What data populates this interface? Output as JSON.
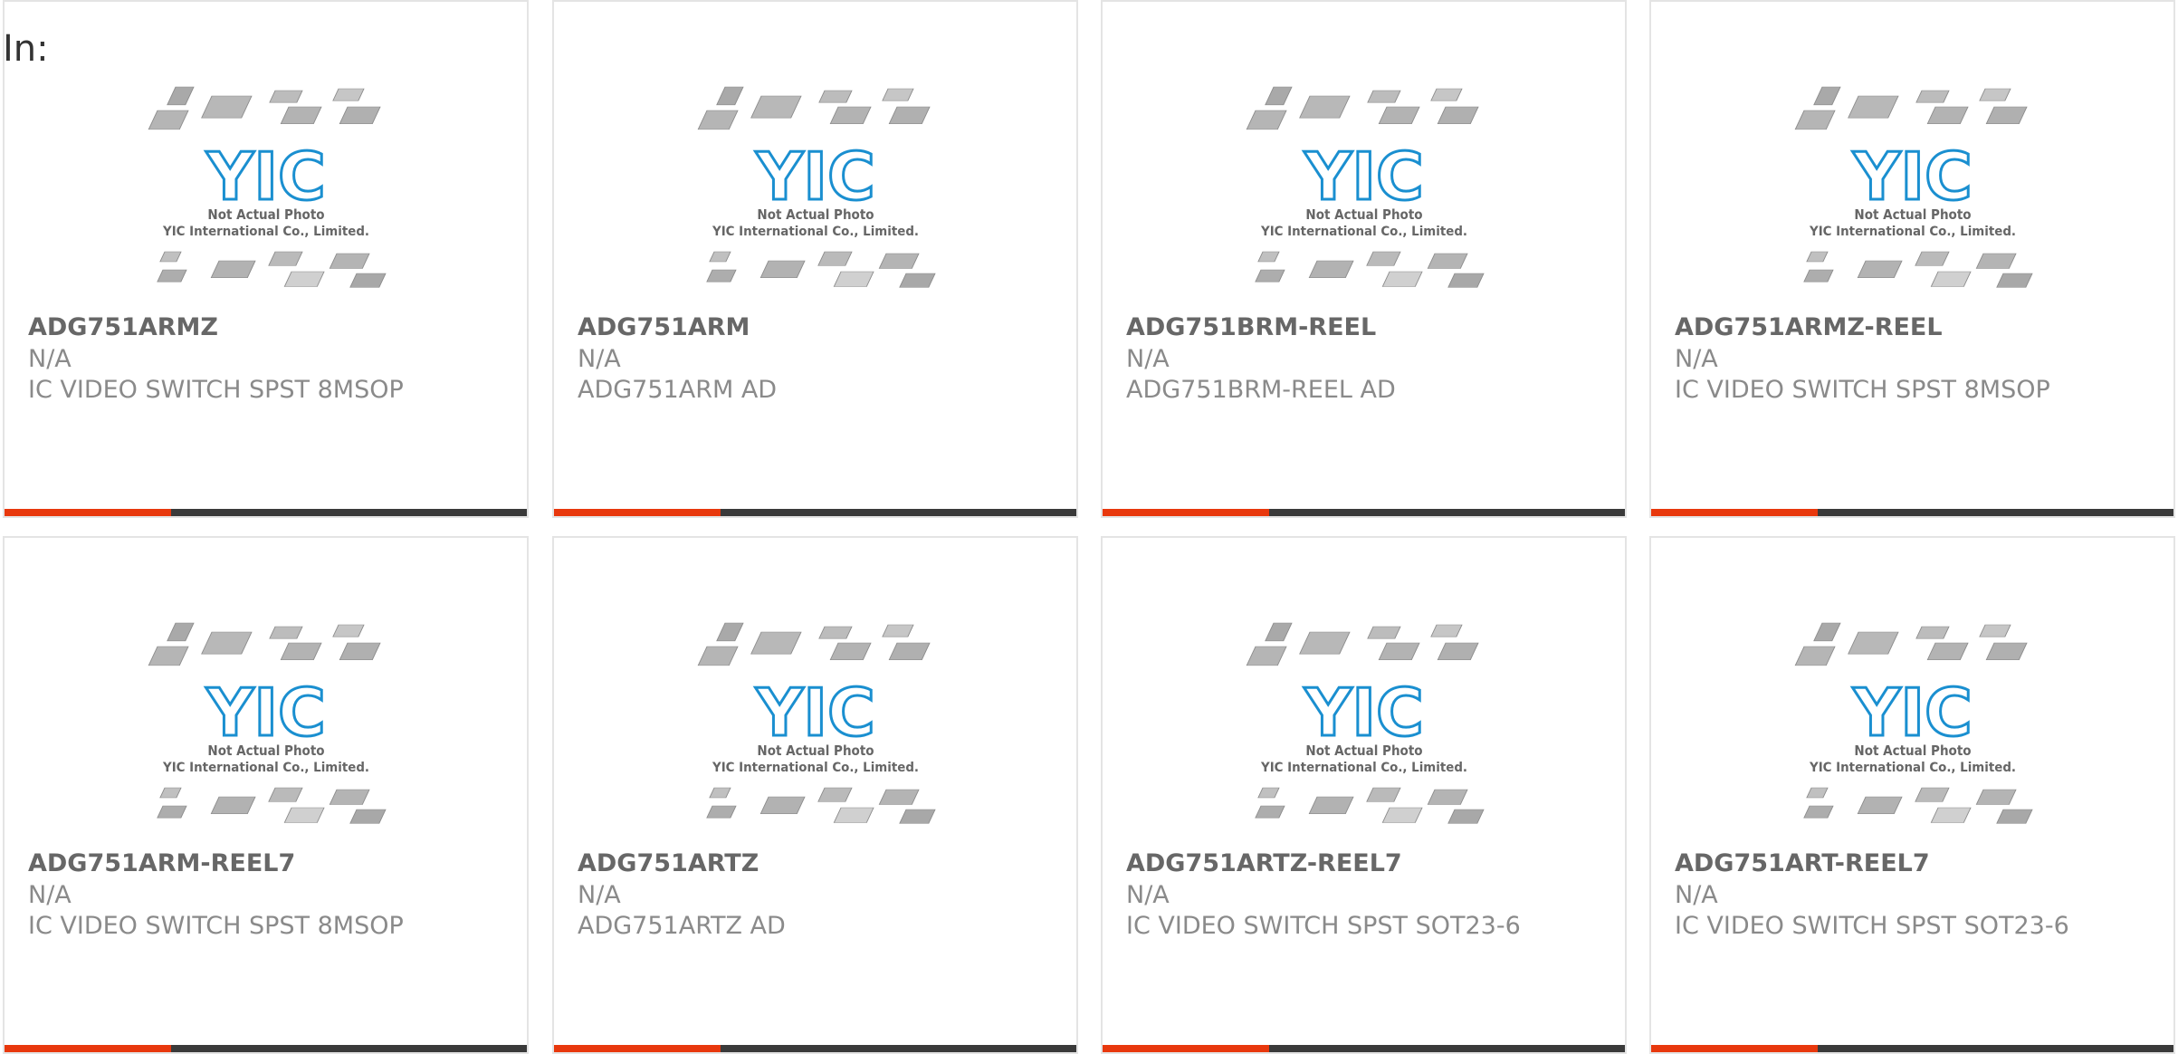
{
  "heading": {
    "label": "In:"
  },
  "colors": {
    "accent": "#e8380d",
    "bar": "#3a3a3a",
    "logo": "#1a8fd0"
  },
  "placeholder": {
    "logo_text": "YIC",
    "caption_line1": "Not Actual Photo",
    "caption_line2": "YIC International Co., Limited."
  },
  "products": [
    {
      "part": "ADG751ARMZ",
      "manufacturer": "N/A",
      "description": "IC VIDEO SWITCH SPST 8MSOP"
    },
    {
      "part": "ADG751ARM",
      "manufacturer": "N/A",
      "description": "ADG751ARM AD"
    },
    {
      "part": "ADG751BRM-REEL",
      "manufacturer": "N/A",
      "description": "ADG751BRM-REEL AD"
    },
    {
      "part": "ADG751ARMZ-REEL",
      "manufacturer": "N/A",
      "description": "IC VIDEO SWITCH SPST 8MSOP"
    },
    {
      "part": "ADG751ARM-REEL7",
      "manufacturer": "N/A",
      "description": "IC VIDEO SWITCH SPST 8MSOP"
    },
    {
      "part": "ADG751ARTZ",
      "manufacturer": "N/A",
      "description": "ADG751ARTZ AD"
    },
    {
      "part": "ADG751ARTZ-REEL7",
      "manufacturer": "N/A",
      "description": "IC VIDEO SWITCH SPST SOT23-6"
    },
    {
      "part": "ADG751ART-REEL7",
      "manufacturer": "N/A",
      "description": "IC VIDEO SWITCH SPST SOT23-6"
    }
  ]
}
